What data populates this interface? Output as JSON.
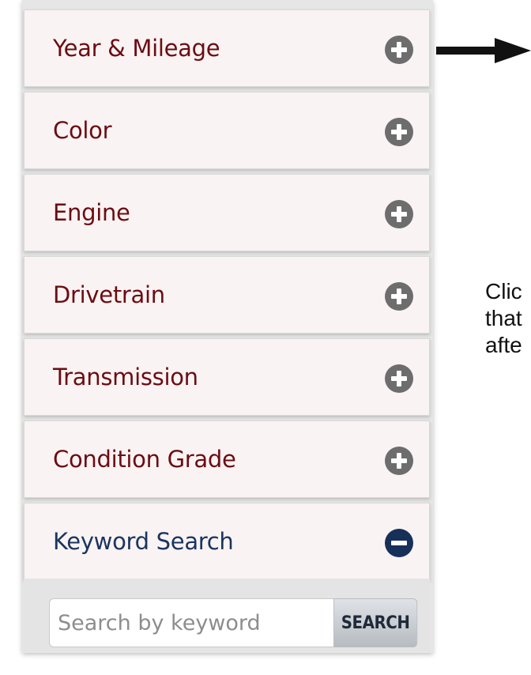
{
  "accordion": {
    "items": [
      {
        "label": "Year & Mileage",
        "state": "collapsed",
        "icon": "plus-circle-icon"
      },
      {
        "label": "Color",
        "state": "collapsed",
        "icon": "plus-circle-icon"
      },
      {
        "label": "Engine",
        "state": "collapsed",
        "icon": "plus-circle-icon"
      },
      {
        "label": "Drivetrain",
        "state": "collapsed",
        "icon": "plus-circle-icon"
      },
      {
        "label": "Transmission",
        "state": "collapsed",
        "icon": "plus-circle-icon"
      },
      {
        "label": "Condition Grade",
        "state": "collapsed",
        "icon": "plus-circle-icon"
      },
      {
        "label": "Keyword Search",
        "state": "expanded",
        "icon": "minus-circle-icon"
      }
    ]
  },
  "keyword_search": {
    "placeholder": "Search by keyword",
    "value": "",
    "button_label": "SEARCH"
  },
  "annotation": {
    "lines": [
      "Clic",
      "that",
      "afte"
    ]
  },
  "colors": {
    "label_collapsed": "#6b0d13",
    "label_expanded": "#1a3560",
    "icon_collapsed": "#6d6d6d",
    "icon_expanded": "#17305a",
    "item_background": "#faf3f3"
  }
}
